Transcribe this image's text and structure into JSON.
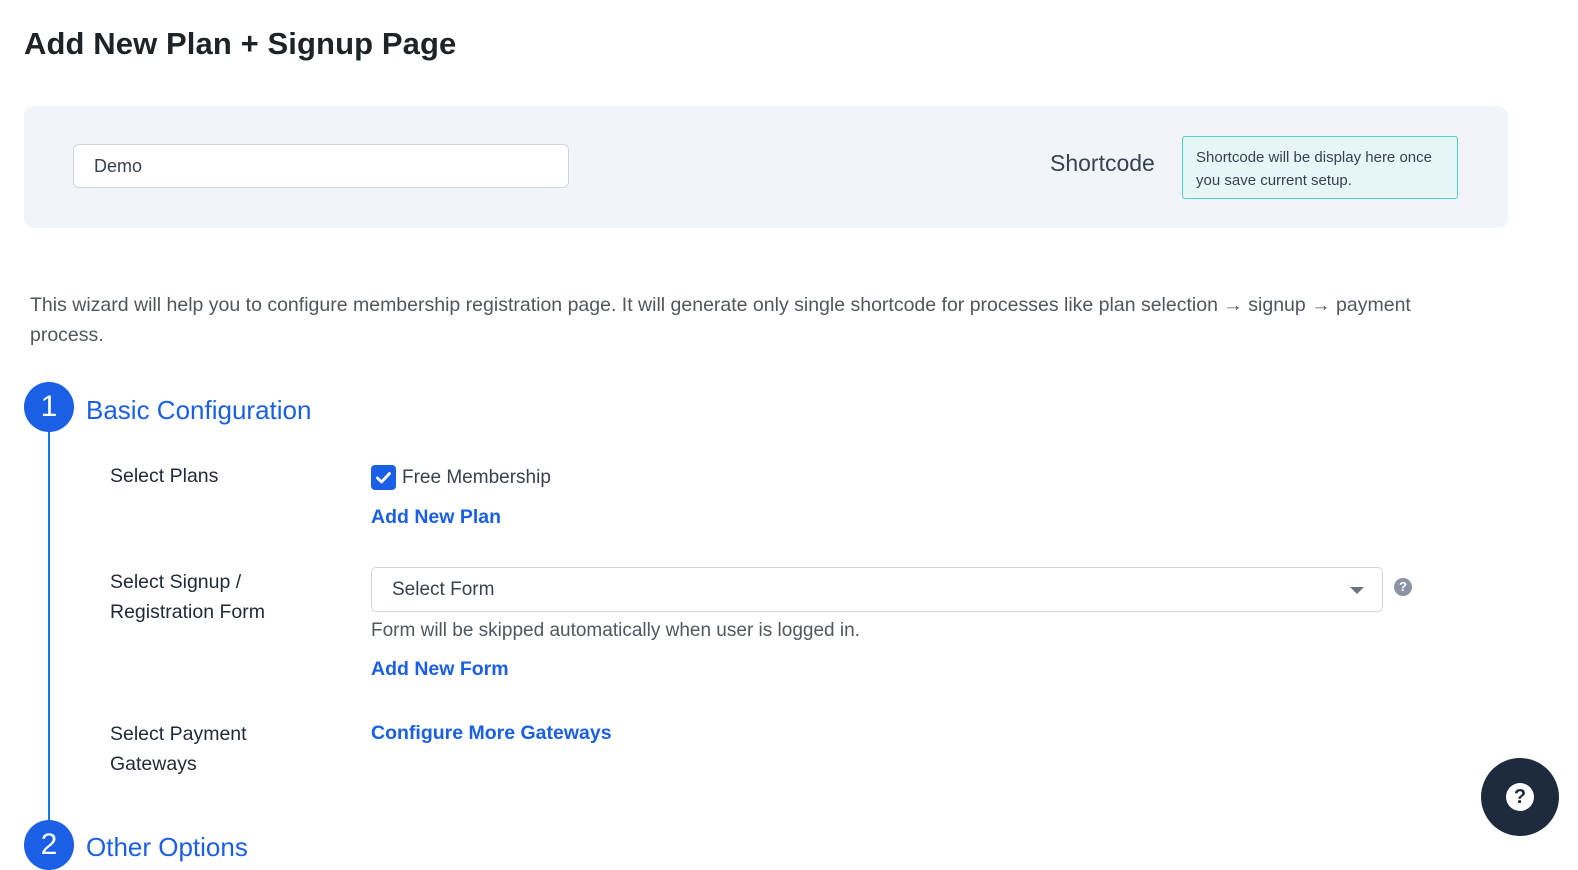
{
  "page": {
    "title": "Add New Plan + Signup Page"
  },
  "top_panel": {
    "plan_name_value": "Demo",
    "shortcode_label": "Shortcode",
    "shortcode_placeholder": "Shortcode will be display here once you save current setup."
  },
  "wizard": {
    "description": "This wizard will help you to configure membership registration page. It will generate only single shortcode for processes like plan selection → signup → payment process.",
    "steps": [
      {
        "number": "1",
        "title": "Basic Configuration",
        "fields": {
          "plans_label": "Select Plans",
          "plan_option": "Free Membership",
          "plan_option_checked": true,
          "add_plan_link": "Add New Plan",
          "form_label": "Select Signup / Registration Form",
          "form_select_value": "Select Form",
          "form_hint": "Form will be skipped automatically when user is logged in.",
          "add_form_link": "Add New Form",
          "gateways_label": "Select Payment Gateways",
          "gateways_link": "Configure More Gateways"
        }
      },
      {
        "number": "2",
        "title": "Other Options"
      }
    ]
  },
  "icons": {
    "checkbox_check": "check-icon",
    "select_arrow": "chevron-down-icon",
    "field_help": "question-circle-icon",
    "floating_help": "help-icon"
  },
  "colors": {
    "accent": "#1a5fe6",
    "panel_bg": "#f1f4f8",
    "shortcode_bg": "#e6f6f6",
    "shortcode_border": "#4fd1c5",
    "help_fab": "#1e2b3c"
  }
}
